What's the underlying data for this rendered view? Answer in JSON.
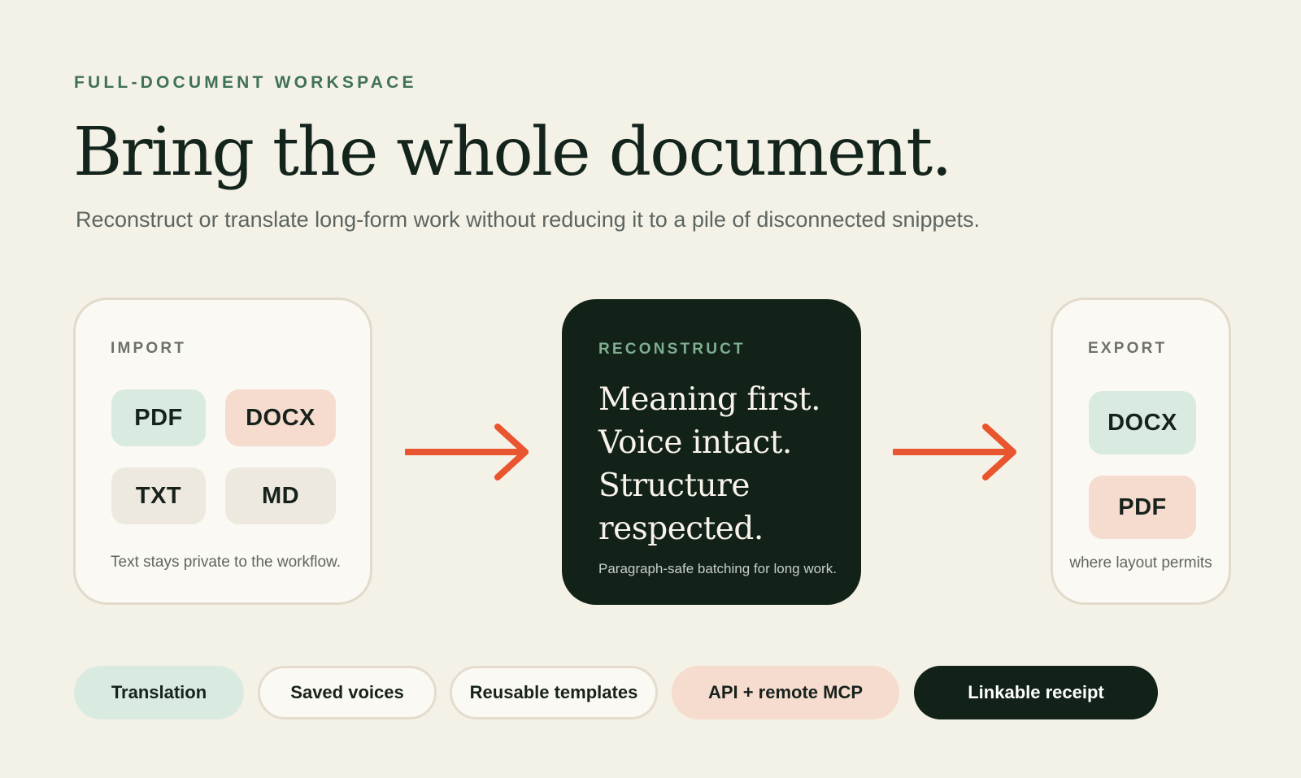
{
  "header": {
    "eyebrow": "FULL-DOCUMENT WORKSPACE",
    "title": "Bring the whole document.",
    "subtitle": "Reconstruct or translate long-form work without reducing it to a pile of disconnected snippets."
  },
  "import_card": {
    "label": "IMPORT",
    "formats": [
      "PDF",
      "DOCX",
      "TXT",
      "MD"
    ],
    "note": "Text stays private to the workflow."
  },
  "reconstruct_card": {
    "label": "RECONSTRUCT",
    "lines": [
      "Meaning first.",
      "Voice intact.",
      "Structure",
      "respected."
    ],
    "note": "Paragraph-safe batching for long work."
  },
  "export_card": {
    "label": "EXPORT",
    "formats": [
      "DOCX",
      "PDF"
    ],
    "note": "where layout permits"
  },
  "features": [
    "Translation",
    "Saved voices",
    "Reusable templates",
    "API + remote MCP",
    "Linkable receipt"
  ],
  "icons": {
    "arrow_1": "arrow-right-icon",
    "arrow_2": "arrow-right-icon"
  },
  "colors": {
    "background": "#f4f1e6",
    "accent_green": "#3f7257",
    "dark": "#122219",
    "arrow": "#e9552f",
    "mint": "#d9ebe1",
    "peach": "#f6dccf"
  }
}
